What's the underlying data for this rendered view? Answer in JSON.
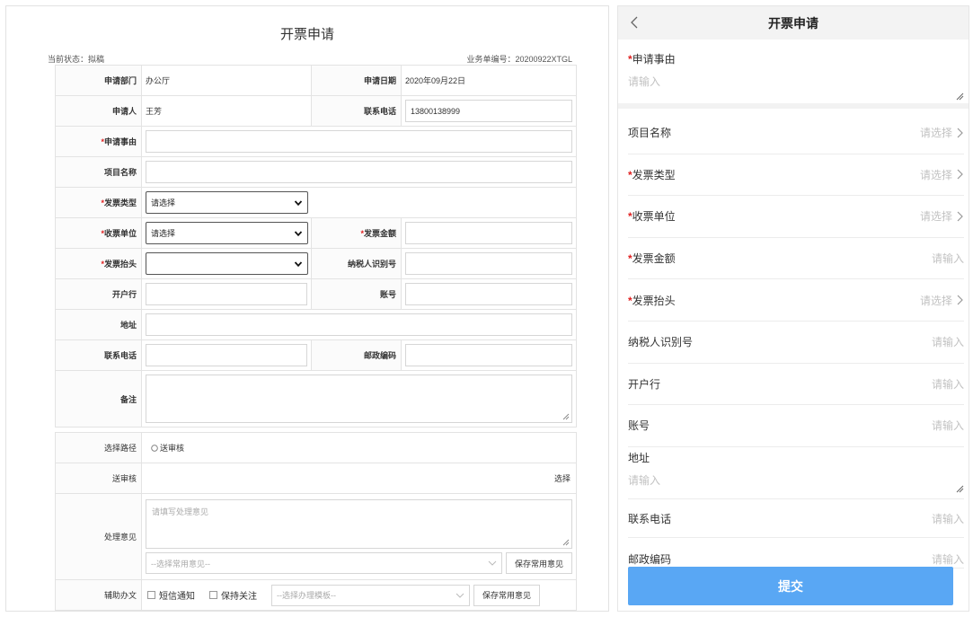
{
  "desktop": {
    "title": "开票申请",
    "status": "当前状态：拟稿",
    "biz_no": "业务单编号：20200922XTGL",
    "labels": {
      "dept": "申请部门",
      "date": "申请日期",
      "applicant": "申请人",
      "phone": "联系电话",
      "reason": "申请事由",
      "project": "项目名称",
      "invoice_type": "发票类型",
      "receiver": "收票单位",
      "amount": "发票金额",
      "header": "发票抬头",
      "tax_id": "纳税人识别号",
      "bank": "开户行",
      "account": "账号",
      "address": "地址",
      "contact_phone": "联系电话",
      "postcode": "邮政编码",
      "remark": "备注"
    },
    "values": {
      "dept": "办公厅",
      "date": "2020年09月22日",
      "applicant": "王芳",
      "phone": "13800138999",
      "invoice_type": "请选择",
      "receiver": "请选择",
      "header": ""
    },
    "workflow": {
      "route_label": "选择路径",
      "route_option": "送审核",
      "review_label": "送审核",
      "review_action": "选择",
      "opinion_label": "处理意见",
      "opinion_placeholder": "请填写处理意见",
      "common_opinion": "--选择常用意见--",
      "save_common": "保存常用意见",
      "assist_label": "辅助办文",
      "sms": "短信通知",
      "follow": "保持关注",
      "template": "--选择办理模板--",
      "save_common2": "保存常用意见"
    }
  },
  "mobile": {
    "title": "开票申请",
    "reason_label": "申请事由",
    "reason_placeholder": "请输入",
    "rows": [
      {
        "label": "项目名称",
        "placeholder": "请选择",
        "required": false
      },
      {
        "label": "发票类型",
        "placeholder": "请选择",
        "required": true
      },
      {
        "label": "收票单位",
        "placeholder": "请选择",
        "required": true
      },
      {
        "label": "发票金额",
        "placeholder": "请输入",
        "required": true
      },
      {
        "label": "发票抬头",
        "placeholder": "请选择",
        "required": true
      },
      {
        "label": "纳税人识别号",
        "placeholder": "请输入",
        "required": false
      },
      {
        "label": "开户行",
        "placeholder": "请输入",
        "required": false
      },
      {
        "label": "账号",
        "placeholder": "请输入",
        "required": false
      }
    ],
    "address_label": "地址",
    "address_placeholder": "请输入",
    "phone_label": "联系电话",
    "phone_placeholder": "请输入",
    "postcode_label": "邮政编码",
    "postcode_placeholder": "请输入",
    "submit": "提交"
  },
  "colors": {
    "required": "#e02020",
    "submit_bg": "#59a7f4",
    "placeholder": "#c2c2c2"
  },
  "icons": [
    "chevron-down-icon",
    "chevron-right-icon",
    "back-icon",
    "resize-grip-icon",
    "checkbox-icon",
    "radio-icon"
  ]
}
